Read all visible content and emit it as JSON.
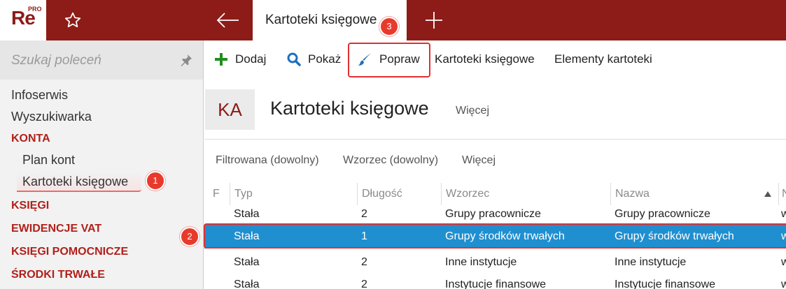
{
  "app": {
    "logo_text": "Re",
    "logo_sup": "PRO"
  },
  "tabs": [
    {
      "label": "Kartoteki księgowe",
      "active": true
    }
  ],
  "sidebar": {
    "search_placeholder": "Szukaj poleceń",
    "items": [
      {
        "label": "Infoserwis",
        "kind": "plain"
      },
      {
        "label": "Wyszukiwarka",
        "kind": "plain"
      },
      {
        "label": "KONTA",
        "kind": "section"
      },
      {
        "label": "Plan kont",
        "kind": "sub"
      },
      {
        "label": "Kartoteki księgowe",
        "kind": "sub",
        "selected": true
      },
      {
        "label": "KSIĘGI",
        "kind": "section"
      },
      {
        "label": "EWIDENCJE VAT",
        "kind": "section"
      },
      {
        "label": "KSIĘGI POMOCNICZE",
        "kind": "section"
      },
      {
        "label": "ŚRODKI TRWAŁE",
        "kind": "section"
      }
    ]
  },
  "toolbar": {
    "add": "Dodaj",
    "show": "Pokaż",
    "edit": "Popraw",
    "records": "Kartoteki księgowe",
    "elements": "Elementy kartoteki"
  },
  "header": {
    "badge": "KA",
    "title": "Kartoteki księgowe",
    "more": "Więcej"
  },
  "filters": [
    "Filtrowana (dowolny)",
    "Wzorzec (dowolny)",
    "Więcej"
  ],
  "table": {
    "columns": [
      "F",
      "Typ",
      "Długość",
      "Wzorzec",
      "Nazwa",
      "N"
    ],
    "rows": [
      {
        "typ": "Stała",
        "dlugosc": "2",
        "wzorzec": "Grupy pracownicze",
        "nazwa": "Grupy pracownicze",
        "extra": "w",
        "selected": false
      },
      {
        "typ": "Stała",
        "dlugosc": "1",
        "wzorzec": "Grupy środków trwałych",
        "nazwa": "Grupy środków trwałych",
        "extra": "w",
        "selected": true
      },
      {
        "typ": "Stała",
        "dlugosc": "2",
        "wzorzec": "Inne instytucje",
        "nazwa": "Inne instytucje",
        "extra": "w",
        "selected": false
      },
      {
        "typ": "Stała",
        "dlugosc": "2",
        "wzorzec": "Instytucje finansowe",
        "nazwa": "Instytucje finansowe",
        "extra": "w",
        "selected": false
      }
    ]
  },
  "annotations": [
    "1",
    "2",
    "3"
  ],
  "colors": {
    "brand": "#8d1b17",
    "accent": "#b1201b",
    "selection": "#1f8fd0",
    "highlight": "#e03030"
  }
}
